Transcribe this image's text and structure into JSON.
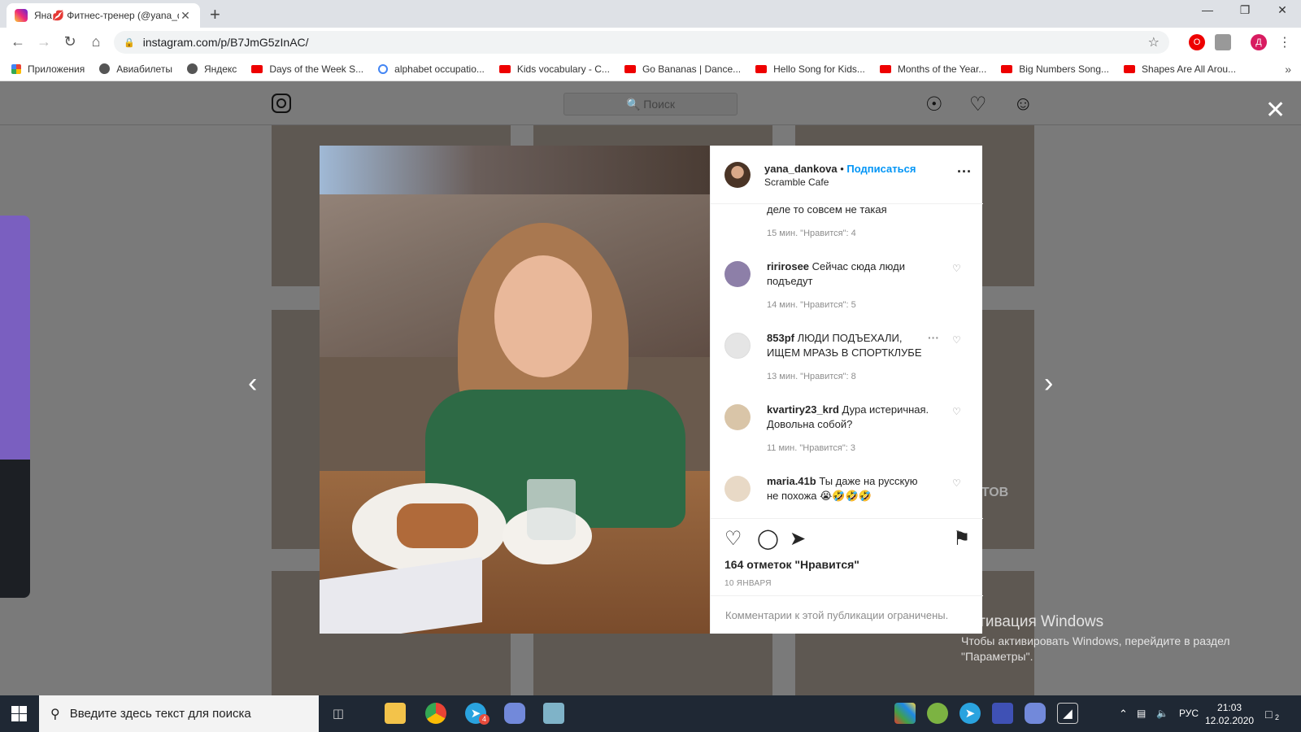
{
  "browser": {
    "tab_title": "Яна💋 Фитнес-тренер (@yana_d",
    "tab_close": "✕",
    "new_tab": "+",
    "url": "instagram.com/p/B7JmG5zInAC/",
    "profile_initial": "Д",
    "bookmarks": [
      {
        "label": "Приложения",
        "icon": "grid"
      },
      {
        "label": "Авиабилеты",
        "icon": "globe"
      },
      {
        "label": "Яндекс",
        "icon": "globe"
      },
      {
        "label": "Days of the Week S...",
        "icon": "yt"
      },
      {
        "label": "alphabet occupatio...",
        "icon": "g"
      },
      {
        "label": "Kids vocabulary - C...",
        "icon": "yt"
      },
      {
        "label": "Go Bananas | Dance...",
        "icon": "yt"
      },
      {
        "label": "Hello Song for Kids...",
        "icon": "yt"
      },
      {
        "label": "Months of the Year...",
        "icon": "yt"
      },
      {
        "label": "Big Numbers Song...",
        "icon": "yt"
      },
      {
        "label": "Shapes Are All Arou...",
        "icon": "yt"
      }
    ]
  },
  "instagram": {
    "search_placeholder": "🔍 Поиск",
    "background_text": "ЕКТОВ"
  },
  "post": {
    "username": "yana_dankova",
    "separator": "•",
    "follow_label": "Подписаться",
    "location": "Scramble Cafe",
    "comment_tail": "деле то совсем не такая",
    "comment_tail_meta": "15 мин.   \"Нравится\": 4",
    "comments": [
      {
        "user": "ririrosee",
        "text": "Сейчас сюда люди подъедут",
        "meta": "14 мин.   \"Нравится\": 5"
      },
      {
        "user": "853pf",
        "text": "ЛЮДИ ПОДЪЕХАЛИ, ИЩЕМ МРАЗЬ В СПОРТКЛУБЕ",
        "meta": "13 мин.   \"Нравится\": 8"
      },
      {
        "user": "kvartiry23_krd",
        "text": "Дура истеричная. Довольна собой?",
        "meta": "11 мин.   \"Нравится\": 3"
      },
      {
        "user": "maria.41b",
        "text": "Ты даже на русскую не похожа 😭🤣🤣🤣",
        "meta": ""
      }
    ],
    "likes": "164 отметок \"Нравится\"",
    "date": "10 ЯНВАРЯ",
    "comments_restricted": "Комментарии к этой публикации ограничены."
  },
  "watermark": {
    "title": "Активация Windows",
    "body": "Чтобы активировать Windows, перейдите в раздел \"Параметры\"."
  },
  "taskbar": {
    "search_placeholder": "Введите здесь текст для поиска",
    "telegram_badge": "4",
    "language": "РУС",
    "time": "21:03",
    "date": "12.02.2020",
    "notifications": "2"
  },
  "colors": {
    "accent": "#0095f6",
    "backdrop": "#777777",
    "taskbar": "#1f2834"
  }
}
